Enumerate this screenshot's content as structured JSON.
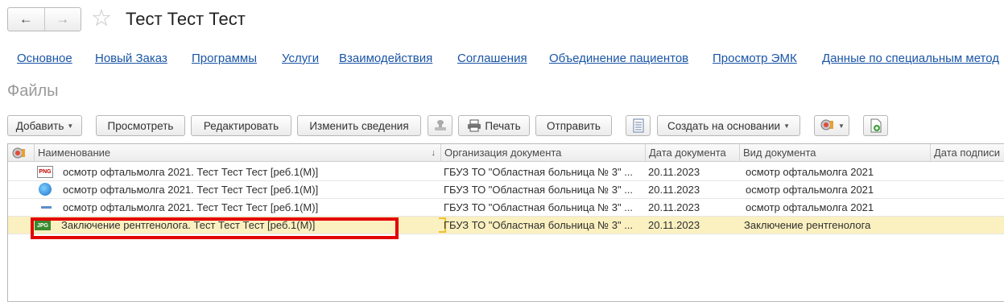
{
  "window": {
    "title": "Тест Тест Тест",
    "back_icon": "arrow-left-icon",
    "forward_icon": "arrow-right-icon",
    "favorite_icon": "star-icon"
  },
  "nav_links": [
    "Основное",
    "Новый Заказ",
    "Программы",
    "Услуги",
    "Взаимодействия",
    "Соглашения",
    "Объединение пациентов",
    "Просмотр ЭМК",
    "Данные по специальным метод"
  ],
  "section_title": "Файлы",
  "toolbar": {
    "add_label": "Добавить",
    "view_label": "Просмотреть",
    "edit_label": "Редактировать",
    "change_info_label": "Изменить сведения",
    "print_label": "Печать",
    "send_label": "Отправить",
    "create_based_label": "Создать на основании"
  },
  "table": {
    "columns": [
      "Наименование",
      "Организация документа",
      "Дата документа",
      "Вид документа",
      "Дата подписи"
    ],
    "rows": [
      {
        "icon": "png-file-icon",
        "name": "осмотр офтальмолга 2021. Тест Тест Тест [реб.1(М)]",
        "org": "ГБУЗ ТО \"Областная больница № 3\" ...",
        "date": "20.11.2023",
        "type": "осмотр офтальмолга 2021",
        "sign_date": ""
      },
      {
        "icon": "web-file-icon",
        "name": "осмотр офтальмолга 2021. Тест Тест Тест [реб.1(М)]",
        "org": "ГБУЗ ТО \"Областная больница № 3\" ...",
        "date": "20.11.2023",
        "type": "осмотр офтальмолга 2021",
        "sign_date": ""
      },
      {
        "icon": "generic-file-icon",
        "name": "осмотр офтальмолга 2021. Тест Тест Тест [реб.1(М)]",
        "org": "ГБУЗ ТО \"Областная больница № 3\" ...",
        "date": "20.11.2023",
        "type": "осмотр офтальмолга 2021",
        "sign_date": ""
      },
      {
        "icon": "jpg-file-icon",
        "name": "Заключение рентгенолога. Тест Тест Тест [реб.1(М)]",
        "org": "ГБУЗ ТО \"Областная больница № 3\" ...",
        "date": "20.11.2023",
        "type": "Заключение рентгенолога",
        "sign_date": ""
      }
    ]
  },
  "file_icon_text": {
    "png": "PNG",
    "jpg": "JPG"
  },
  "colors": {
    "link": "#1a55a6",
    "selected_row": "#fbf0c0",
    "highlight": "#e30000"
  }
}
